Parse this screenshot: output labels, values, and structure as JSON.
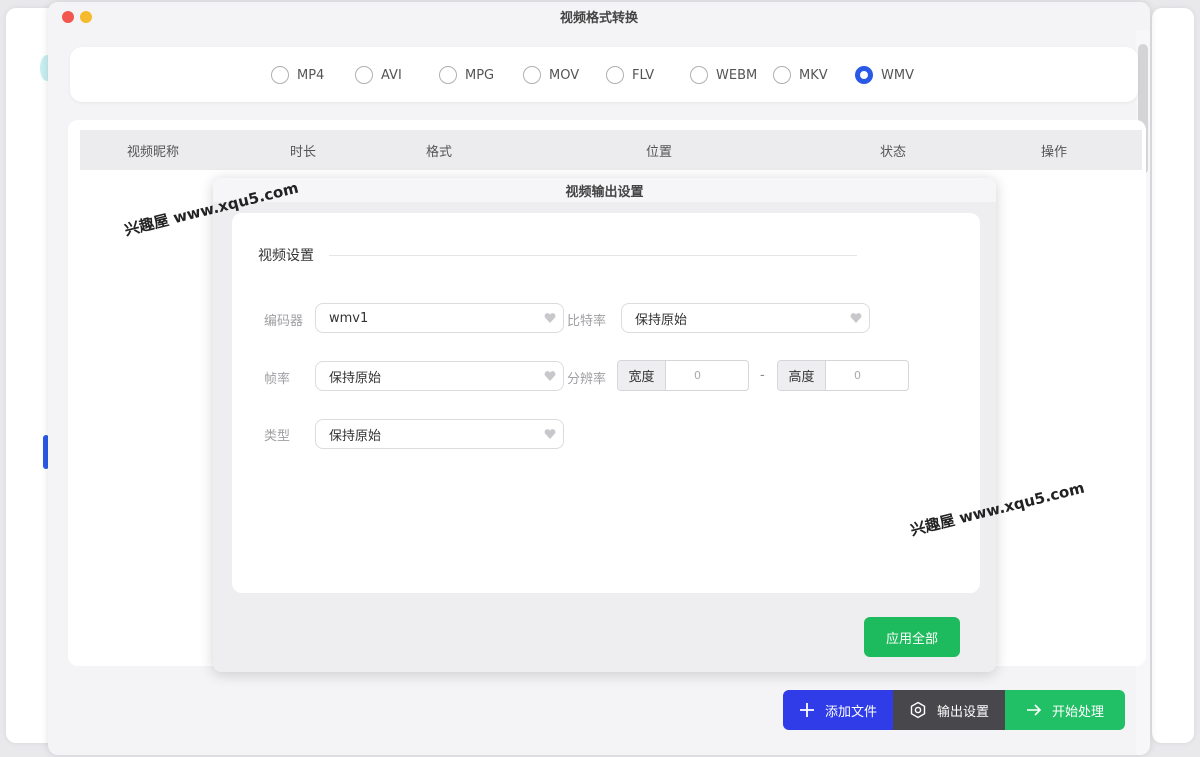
{
  "window": {
    "title": "视频格式转换"
  },
  "formats": [
    {
      "label": "MP4",
      "checked": false
    },
    {
      "label": "AVI",
      "checked": false
    },
    {
      "label": "MPG",
      "checked": false
    },
    {
      "label": "MOV",
      "checked": false
    },
    {
      "label": "FLV",
      "checked": false
    },
    {
      "label": "WEBM",
      "checked": false
    },
    {
      "label": "MKV",
      "checked": false
    },
    {
      "label": "WMV",
      "checked": true
    }
  ],
  "table": {
    "columns": [
      "视频昵称",
      "时长",
      "格式",
      "位置",
      "状态",
      "操作"
    ]
  },
  "toolbar": {
    "add_label": "添加文件",
    "output_label": "输出设置",
    "start_label": "开始处理"
  },
  "modal": {
    "title": "视频输出设置",
    "section": "视频设置",
    "encoder_label": "编码器",
    "encoder_value": "wmv1",
    "bitrate_label": "比特率",
    "bitrate_value": "保持原始",
    "framerate_label": "帧率",
    "framerate_value": "保持原始",
    "resolution_label": "分辨率",
    "width_label": "宽度",
    "width_value": "0",
    "height_label": "高度",
    "height_value": "0",
    "dash": "-",
    "type_label": "类型",
    "type_value": "保持原始",
    "apply_label": "应用全部"
  },
  "watermarks": [
    "兴趣屋 www.xqu5.com",
    "兴趣屋 www.xqu5.com"
  ],
  "colors": {
    "accent_blue": "#2f3ce8",
    "dark_gray": "#48484c",
    "green": "#22c066"
  }
}
